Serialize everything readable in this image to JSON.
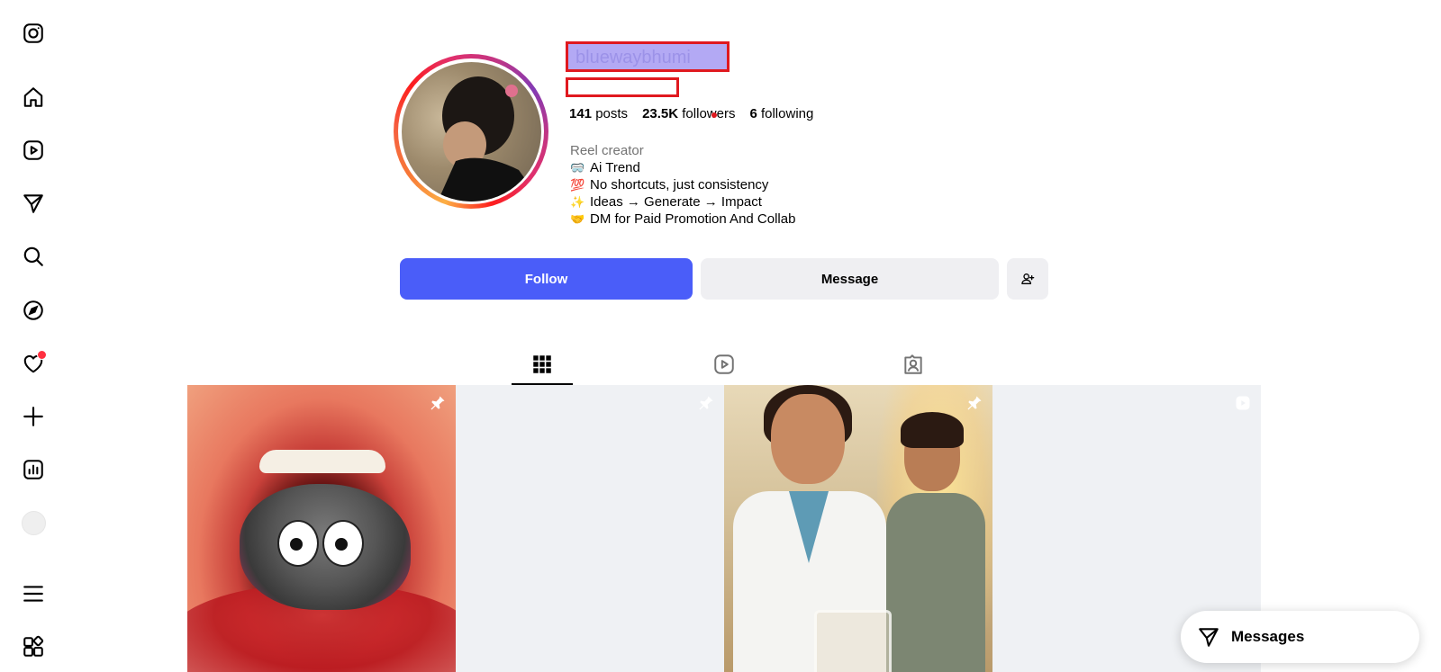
{
  "sidebar": {
    "items": [
      {
        "icon": "instagram-logo-icon"
      },
      {
        "icon": "home-icon"
      },
      {
        "icon": "reels-icon"
      },
      {
        "icon": "send-icon"
      },
      {
        "icon": "search-icon"
      },
      {
        "icon": "explore-icon"
      },
      {
        "icon": "heart-icon"
      },
      {
        "icon": "plus-icon"
      },
      {
        "icon": "dashboard-icon"
      },
      {
        "icon": "avatar"
      },
      {
        "icon": "menu-icon"
      },
      {
        "icon": "apps-icon"
      }
    ]
  },
  "profile": {
    "username": "bluewaybhumi",
    "stats": {
      "posts_count": "141",
      "posts_label": "posts",
      "followers_count": "23.5K",
      "followers_label": "followers",
      "following_count": "6",
      "following_label": "following"
    },
    "bio": {
      "category": "Reel creator",
      "lines": [
        {
          "emoji": "🥽",
          "text": "Ai Trend"
        },
        {
          "emoji": "💯",
          "text": "No shortcuts, just consistency"
        },
        {
          "emoji": "✨",
          "text": "Ideas → Generate → Impact"
        },
        {
          "emoji": "🤝",
          "text": "DM for Paid Promotion And Collab"
        }
      ]
    },
    "buttons": {
      "follow": "Follow",
      "message": "Message"
    }
  },
  "tabs": [
    {
      "name": "posts",
      "icon": "grid-icon",
      "active": true
    },
    {
      "name": "reels",
      "icon": "reels-icon",
      "active": false
    },
    {
      "name": "tagged",
      "icon": "tagged-icon",
      "active": false
    }
  ],
  "posts": [
    {
      "badge": "pin-icon"
    },
    {
      "badge": "pin-icon"
    },
    {
      "badge": "pin-icon"
    },
    {
      "badge": "reel-icon"
    }
  ],
  "messages": {
    "label": "Messages"
  },
  "colors": {
    "follow_button": "#4a5df9",
    "secondary_button": "#efeff2",
    "notification_dot": "#ff3040"
  }
}
